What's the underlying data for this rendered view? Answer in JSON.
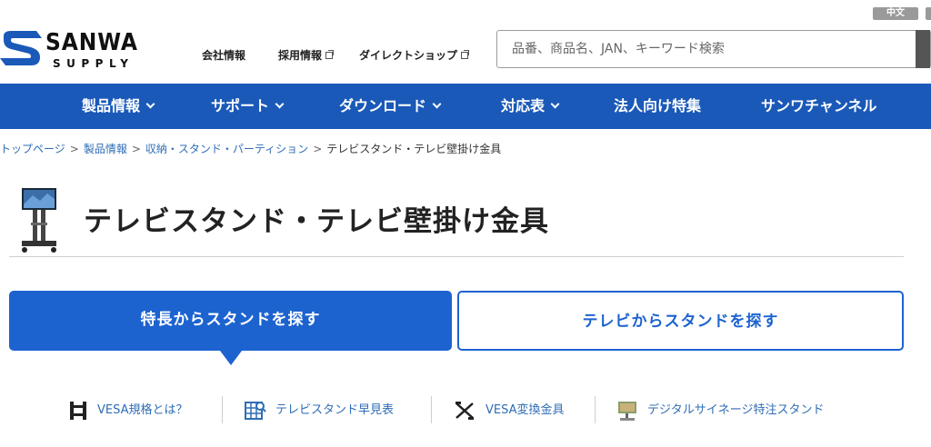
{
  "lang": {
    "zh": "中文"
  },
  "logo": {
    "word": "SANWA",
    "supply": "SUPPLY"
  },
  "header": {
    "links": [
      {
        "label": "会社情報",
        "external": false
      },
      {
        "label": "採用情報",
        "external": true
      },
      {
        "label": "ダイレクトショップ",
        "external": true
      }
    ],
    "search": {
      "placeholder": "品番、商品名、JAN、キーワード検索",
      "value": ""
    }
  },
  "nav": [
    {
      "label": "製品情報",
      "dropdown": true
    },
    {
      "label": "サポート",
      "dropdown": true
    },
    {
      "label": "ダウンロード",
      "dropdown": true
    },
    {
      "label": "対応表",
      "dropdown": true
    },
    {
      "label": "法人向け特集",
      "dropdown": false
    },
    {
      "label": "サンワチャンネル",
      "dropdown": false
    }
  ],
  "breadcrumb": {
    "items": [
      "トップページ",
      "製品情報",
      "収納・スタンド・パーティション"
    ],
    "current": "テレビスタンド・テレビ壁掛け金具",
    "separator": ">"
  },
  "page": {
    "title": "テレビスタンド・テレビ壁掛け金具"
  },
  "tabs": [
    {
      "label": "特長からスタンドを探す",
      "active": true
    },
    {
      "label": "テレビからスタンドを探す",
      "active": false
    }
  ],
  "sublinks": [
    {
      "label": "VESA規格とは？",
      "icon": "vesa-bracket-icon"
    },
    {
      "label": "テレビスタンド早見表",
      "icon": "table-search-icon"
    },
    {
      "label": "VESA変換金具",
      "icon": "adapter-plate-icon"
    },
    {
      "label": "デジタルサイネージ特注スタンド",
      "icon": "signage-stand-icon"
    }
  ],
  "colors": {
    "brand": "#1a59b8",
    "accent": "#1d63d0",
    "link": "#2f6db5"
  }
}
